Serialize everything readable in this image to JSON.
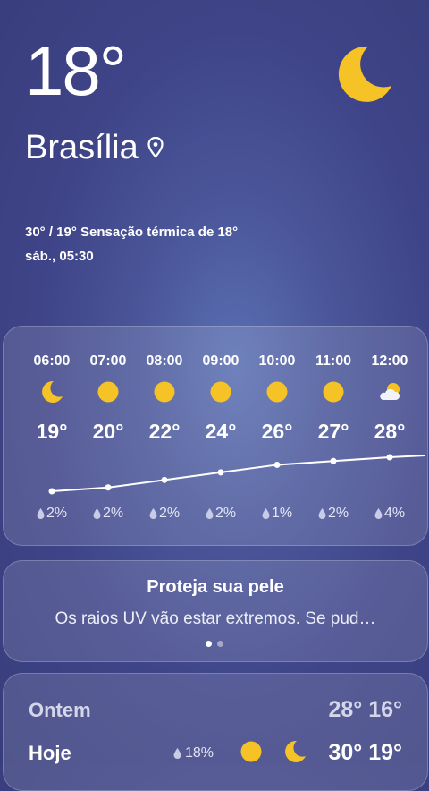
{
  "current": {
    "temperature": "18°",
    "city": "Brasília",
    "details_line1": "30° / 19° Sensação térmica de 18°",
    "details_line2": "sáb., 05:30",
    "icon": "moon-icon"
  },
  "hourly": [
    {
      "time": "06:00",
      "temp": "19°",
      "temp_value": 19,
      "precip": "2%",
      "icon": "moon-icon"
    },
    {
      "time": "07:00",
      "temp": "20°",
      "temp_value": 20,
      "precip": "2%",
      "icon": "sun-icon"
    },
    {
      "time": "08:00",
      "temp": "22°",
      "temp_value": 22,
      "precip": "2%",
      "icon": "sun-icon"
    },
    {
      "time": "09:00",
      "temp": "24°",
      "temp_value": 24,
      "precip": "2%",
      "icon": "sun-icon"
    },
    {
      "time": "10:00",
      "temp": "26°",
      "temp_value": 26,
      "precip": "1%",
      "icon": "sun-icon"
    },
    {
      "time": "11:00",
      "temp": "27°",
      "temp_value": 27,
      "precip": "2%",
      "icon": "sun-icon"
    },
    {
      "time": "12:00",
      "temp": "28°",
      "temp_value": 28,
      "precip": "4%",
      "icon": "partly-cloudy-icon"
    }
  ],
  "uv": {
    "title": "Proteja sua pele",
    "text": "Os raios UV vão estar extremos. Se pud…",
    "page": 1,
    "pages": 2
  },
  "daily": [
    {
      "day": "Ontem",
      "hilo": "28° 16°"
    },
    {
      "day": "Hoje",
      "precip": "18%",
      "hilo": "30° 19°",
      "day_icon": "sun-icon",
      "night_icon": "moon-icon"
    }
  ],
  "colors": {
    "accent_yellow": "#f6c326",
    "background": "#3f4488"
  }
}
